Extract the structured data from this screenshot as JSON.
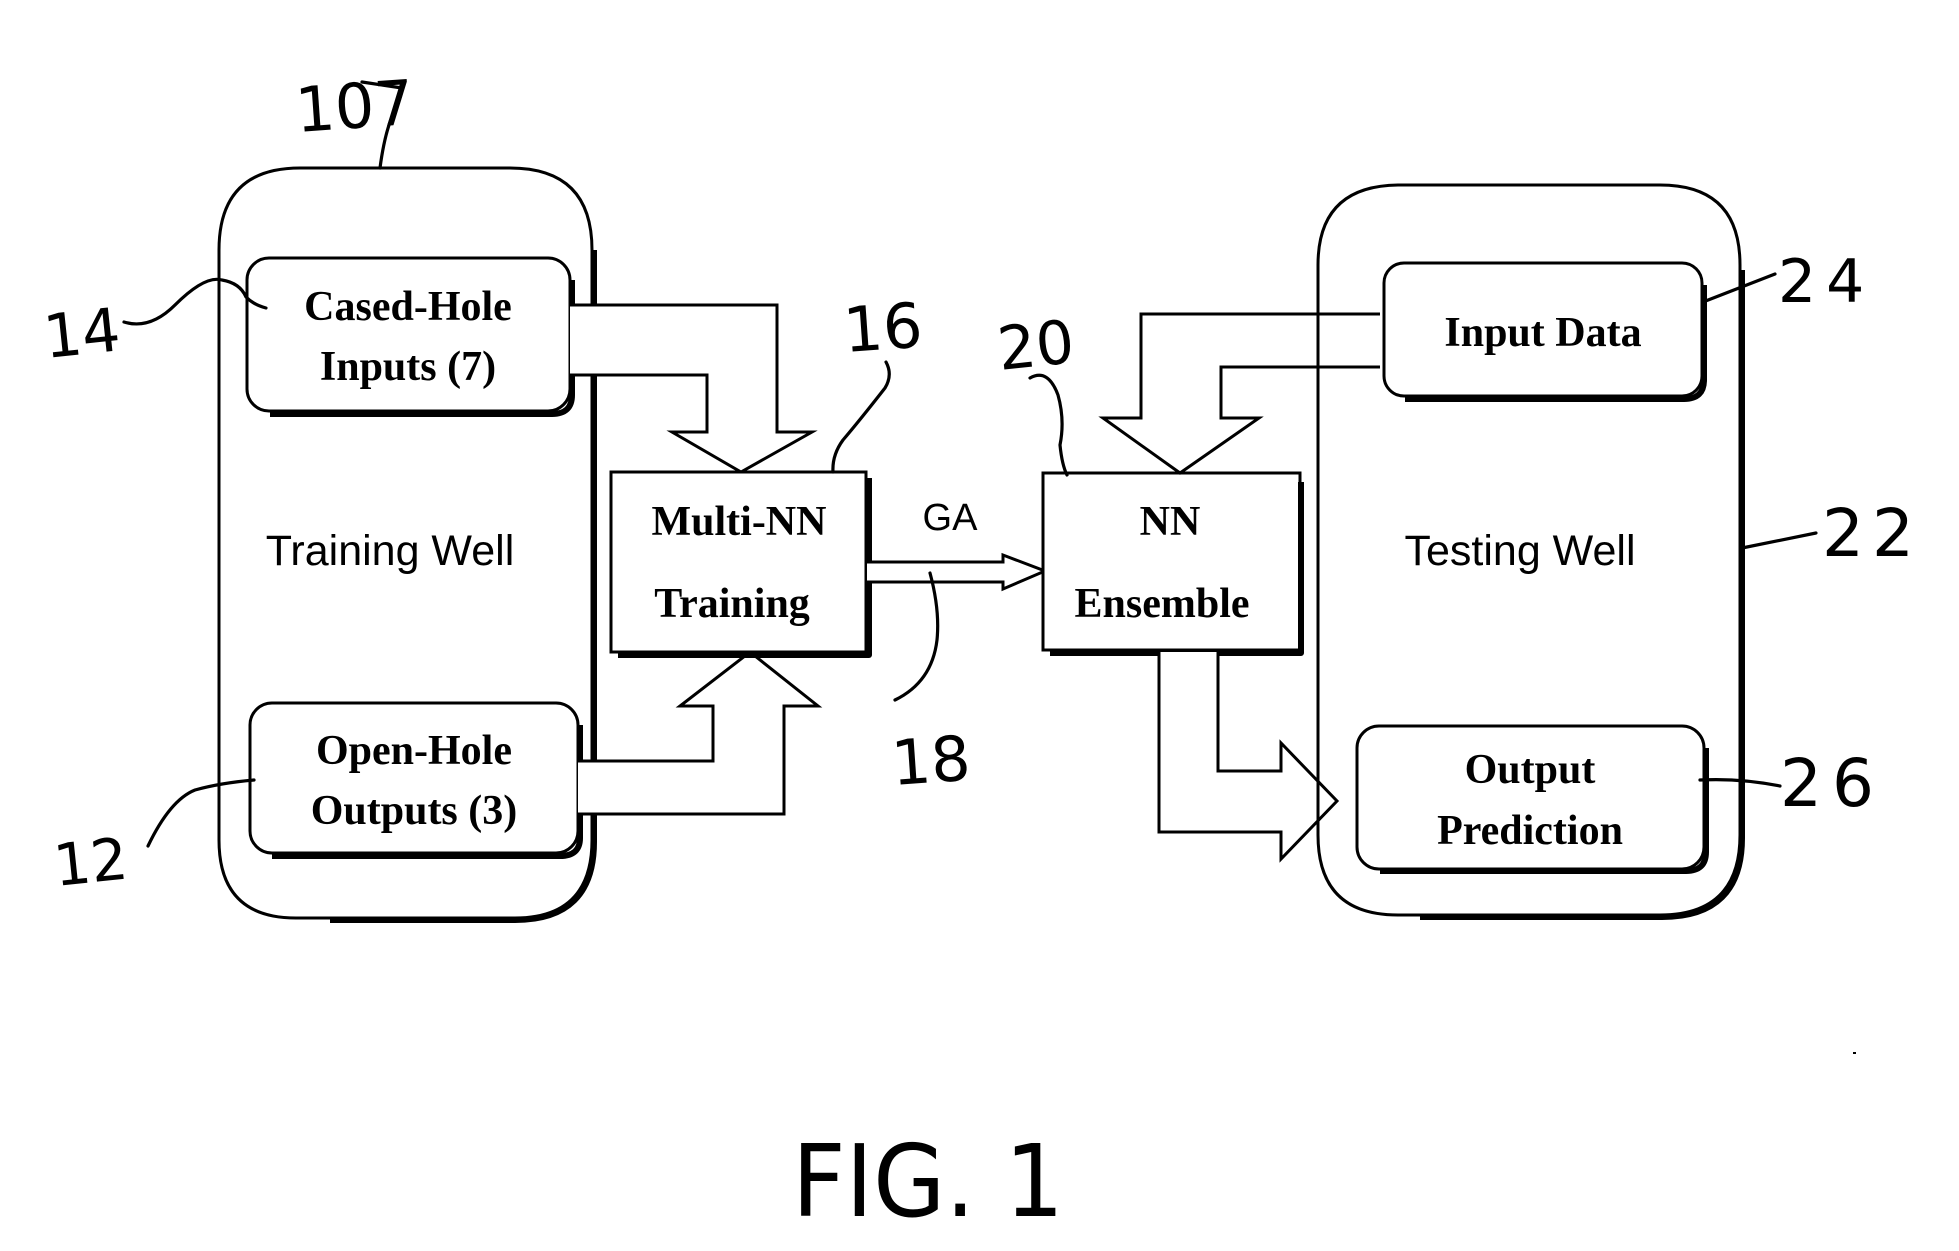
{
  "figure": {
    "caption": "FIG. 1",
    "colors": {
      "ink": "#000000",
      "background": "#ffffff"
    }
  },
  "training_well": {
    "ref": "107",
    "label": "Training Well",
    "cased_hole": {
      "ref": "14",
      "line1": "Cased-Hole",
      "line2": "Inputs (7)"
    },
    "open_hole": {
      "ref": "12",
      "line1": "Open-Hole",
      "line2": "Outputs (3)"
    }
  },
  "multi_nn": {
    "ref": "16",
    "line1": "Multi-NN",
    "line2": "Training"
  },
  "ga_link": {
    "ref": "18",
    "label": "GA"
  },
  "nn_ensemble": {
    "ref": "20",
    "line1": "NN",
    "line2": "Ensemble"
  },
  "testing_well": {
    "ref": "22",
    "label": "Testing Well",
    "input_data": {
      "ref": "24",
      "label": "Input Data"
    },
    "output_prediction": {
      "ref": "26",
      "line1": "Output",
      "line2": "Prediction"
    }
  },
  "edges": [
    {
      "from": "Cased-Hole Inputs (7)",
      "to": "Multi-NN Training"
    },
    {
      "from": "Open-Hole Outputs (3)",
      "to": "Multi-NN Training"
    },
    {
      "from": "Multi-NN Training",
      "to": "NN Ensemble",
      "label": "GA"
    },
    {
      "from": "Input Data",
      "to": "NN Ensemble"
    },
    {
      "from": "NN Ensemble",
      "to": "Output Prediction"
    }
  ]
}
